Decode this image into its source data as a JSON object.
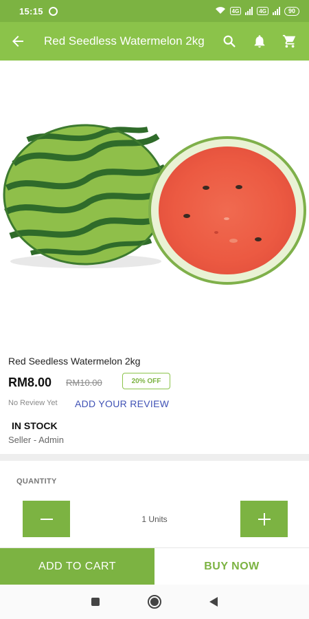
{
  "status_bar": {
    "time": "15:15",
    "battery": "90",
    "network_1": "4G",
    "network_2": "4G"
  },
  "app_bar": {
    "title": "Red Seedless Watermelon 2kg",
    "back_icon": "arrow-left-icon",
    "search_icon": "search-icon",
    "notification_icon": "bell-icon",
    "cart_icon": "cart-icon"
  },
  "product": {
    "name": "Red Seedless Watermelon 2kg",
    "price": "RM8.00",
    "old_price": "RM10.00",
    "discount": "20% OFF",
    "no_review": "No Review Yet",
    "add_review": "ADD YOUR REVIEW",
    "stock": "IN STOCK",
    "seller": "Seller - Admin"
  },
  "quantity": {
    "label": "QUANTITY",
    "value": "1 Units",
    "minus_icon": "minus-icon",
    "plus_icon": "plus-icon"
  },
  "actions": {
    "add_to_cart": "ADD TO CART",
    "buy_now": "BUY NOW"
  },
  "colors": {
    "brand": "#8bc34a",
    "brand_dark": "#7cb342",
    "link": "#3f51b5"
  }
}
